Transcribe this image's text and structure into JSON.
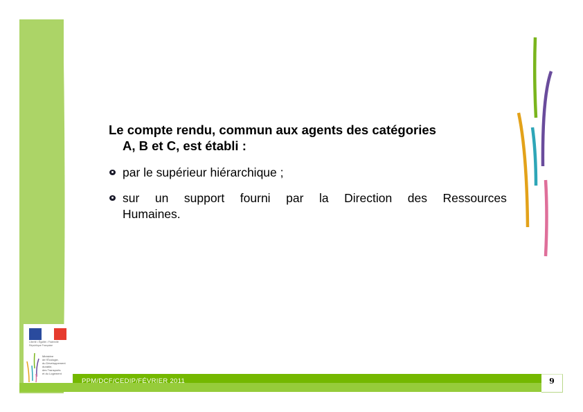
{
  "slide": {
    "heading_line1": "Le compte rendu, commun aux agents des catégories",
    "heading_line2": "A, B et C, est établi :",
    "bullets": [
      {
        "text": "par le supérieur hiérarchique ;"
      },
      {
        "line1_words": [
          "sur",
          "un",
          "support",
          "fourni",
          "par",
          "la",
          "Direction",
          "des",
          "Ressources"
        ],
        "line2": "Humaines."
      }
    ]
  },
  "footer": {
    "text": "PPM/DCF/CEDIP/FÉVRIER 2011",
    "page_number": "9"
  },
  "logo": {
    "caption": "Liberté • Égalité • Fraternité République Française",
    "ministry_lines": [
      "Ministère",
      "de l'Écologie,",
      "du Développement",
      "durable,",
      "des Transports",
      "et du Logement"
    ]
  },
  "colors": {
    "green_column": "#acd467",
    "footer_dark": "#74b800",
    "footer_light": "#96cc3a",
    "deco_green": "#7ab51d",
    "deco_purple": "#6a4c9c",
    "deco_orange": "#e3a21a",
    "deco_teal": "#2ea6b8",
    "deco_pink": "#df6f9a"
  }
}
